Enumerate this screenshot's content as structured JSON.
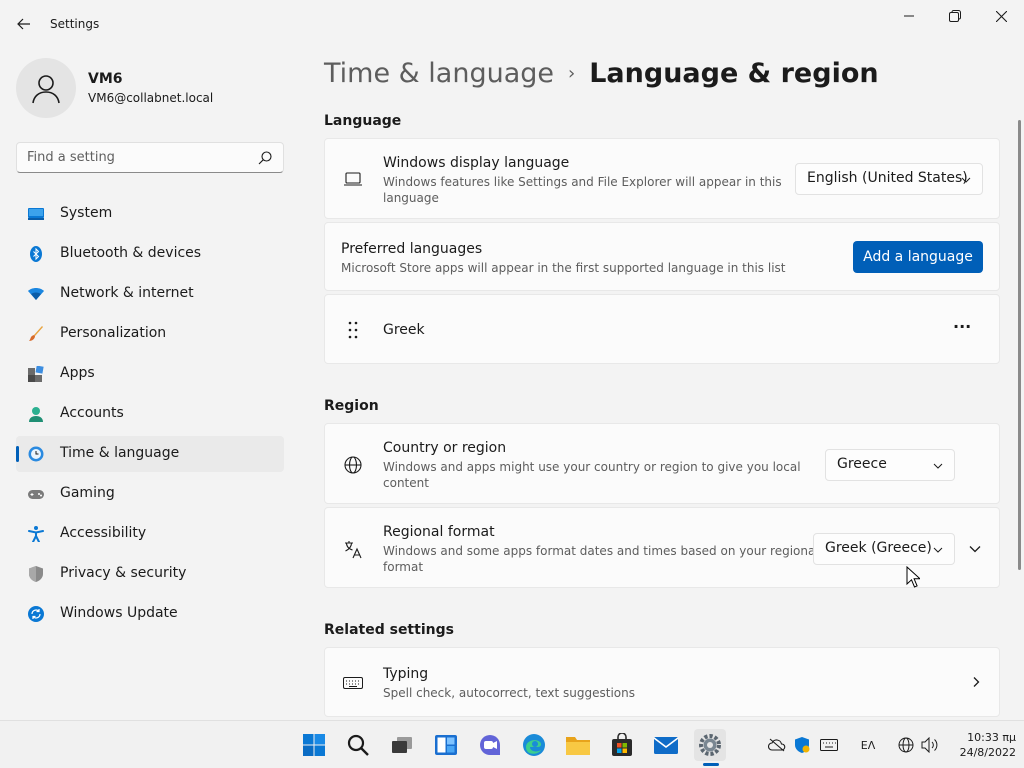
{
  "window": {
    "title": "Settings"
  },
  "profile": {
    "name": "VM6",
    "email": "VM6@collabnet.local"
  },
  "search": {
    "placeholder": "Find a setting"
  },
  "sidebar": {
    "items": [
      {
        "label": "System",
        "icon": "system-icon",
        "active": false
      },
      {
        "label": "Bluetooth & devices",
        "icon": "bluetooth-icon",
        "active": false
      },
      {
        "label": "Network & internet",
        "icon": "network-icon",
        "active": false
      },
      {
        "label": "Personalization",
        "icon": "brush-icon",
        "active": false
      },
      {
        "label": "Apps",
        "icon": "apps-icon",
        "active": false
      },
      {
        "label": "Accounts",
        "icon": "accounts-icon",
        "active": false
      },
      {
        "label": "Time & language",
        "icon": "time-language-icon",
        "active": true
      },
      {
        "label": "Gaming",
        "icon": "gaming-icon",
        "active": false
      },
      {
        "label": "Accessibility",
        "icon": "accessibility-icon",
        "active": false
      },
      {
        "label": "Privacy & security",
        "icon": "shield-icon",
        "active": false
      },
      {
        "label": "Windows Update",
        "icon": "update-icon",
        "active": false
      }
    ]
  },
  "breadcrumb": {
    "parent": "Time & language",
    "separator": "›",
    "current": "Language & region"
  },
  "language_section": {
    "title": "Language",
    "display_language": {
      "title": "Windows display language",
      "desc_line1": "Windows features like Settings and File Explorer will appear in this",
      "desc_line2": "language",
      "value": "English (United States)"
    },
    "preferred": {
      "title": "Preferred languages",
      "desc": "Microsoft Store apps will appear in the first supported language in this list",
      "button": "Add a language"
    },
    "languages": [
      {
        "name": "Greek",
        "more": "···"
      }
    ]
  },
  "region_section": {
    "title": "Region",
    "country": {
      "title": "Country or region",
      "desc_line1": "Windows and apps might use your country or region to give you local",
      "desc_line2": "content",
      "value": "Greece"
    },
    "format": {
      "title": "Regional format",
      "desc_line1": "Windows and some apps format dates and times based on your regional",
      "desc_line2": "format",
      "value": "Greek (Greece)"
    }
  },
  "related_section": {
    "title": "Related settings",
    "typing": {
      "title": "Typing",
      "desc": "Spell check, autocorrect, text suggestions"
    }
  },
  "taskbar": {
    "apps": [
      "start-icon",
      "search-icon",
      "task-view-icon",
      "widgets-icon",
      "chat-icon",
      "edge-icon",
      "file-explorer-icon",
      "store-icon",
      "mail-icon",
      "settings-icon"
    ],
    "input_indicator": "ΕΛ",
    "time": "10:33 πμ",
    "date": "24/8/2022"
  },
  "colors": {
    "accent": "#005fb8",
    "background": "#f3f3f3",
    "card": "#fbfbfb"
  }
}
